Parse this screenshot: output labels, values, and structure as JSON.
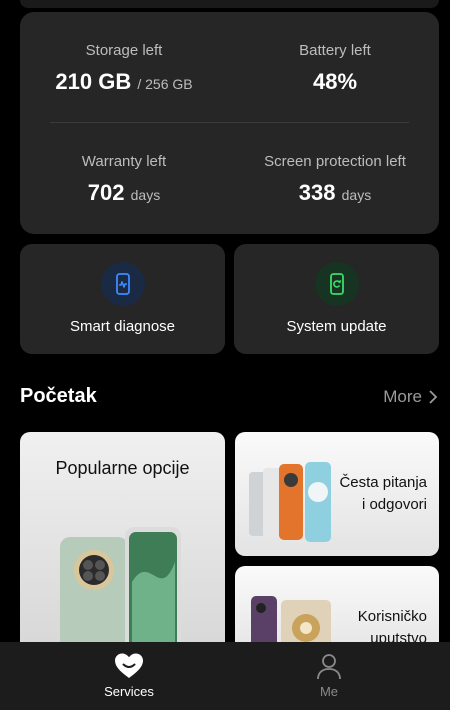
{
  "stats": {
    "storage": {
      "label": "Storage left",
      "value": "210 GB",
      "sub": "/ 256 GB"
    },
    "battery": {
      "label": "Battery left",
      "value": "48%"
    },
    "warranty": {
      "label": "Warranty left",
      "value": "702",
      "sub": "days"
    },
    "screen": {
      "label": "Screen protection left",
      "value": "338",
      "sub": "days"
    }
  },
  "tools": {
    "diagnose": {
      "label": "Smart diagnose",
      "icon": "phone-diagnose-icon"
    },
    "update": {
      "label": "System update",
      "icon": "phone-update-icon"
    }
  },
  "section": {
    "title": "Početak",
    "more": "More"
  },
  "promos": {
    "popular": "Popularne opcije",
    "faq_line1": "Česta pitanja",
    "faq_line2": "i odgovori",
    "manual_line1": "Korisničko",
    "manual_line2": "uputstvo"
  },
  "nav": {
    "services": {
      "label": "Services",
      "icon": "heart-icon"
    },
    "me": {
      "label": "Me",
      "icon": "person-icon"
    }
  },
  "colors": {
    "background": "#000000",
    "card": "#262626",
    "diagnose_accent": "#3d8bff",
    "update_accent": "#3ddc6b"
  }
}
